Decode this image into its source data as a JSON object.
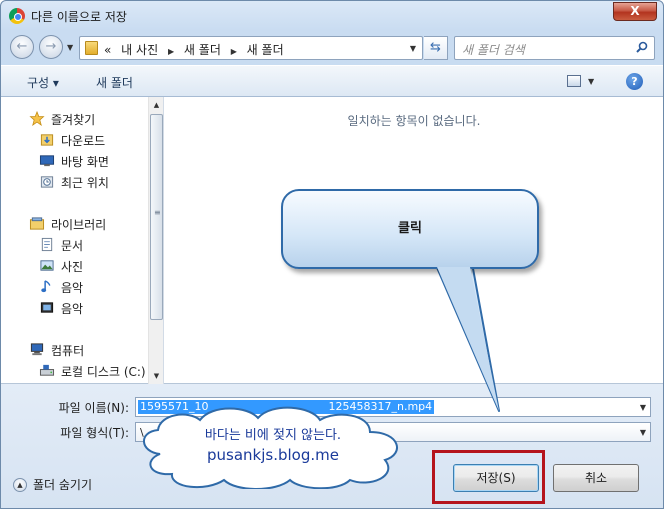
{
  "window": {
    "title": "다른 이름으로 저장",
    "close_symbol": "X"
  },
  "address": {
    "prefix": "«",
    "crumbs": [
      "내 사진",
      "새 폴더",
      "새 폴더"
    ],
    "search_placeholder": "새 폴더 검색"
  },
  "toolbar": {
    "organize": "구성 ▾",
    "new_folder": "새 폴더",
    "help": "?"
  },
  "nav": {
    "favorites": "즐겨찾기",
    "downloads": "다운로드",
    "desktop": "바탕 화면",
    "recent": "최근 위치",
    "libraries": "라이브러리",
    "documents": "문서",
    "pictures": "사진",
    "music1": "음악",
    "music2": "음악",
    "computer": "컴퓨터",
    "local_disk": "로컬 디스크 (C:)"
  },
  "main": {
    "empty_message": "일치하는 항목이 없습니다."
  },
  "fields": {
    "filename_label": "파일 이름(N):",
    "filename_value": "1595571_10",
    "filename_value_tail": "125458317_n.mp4",
    "filetype_label": "파일 형식(T):",
    "filetype_value": "\\"
  },
  "footer": {
    "hide_folders": "폴더 숨기기",
    "save_label": "저장(S)",
    "cancel_label": "취소"
  },
  "annotations": {
    "callout_text": "클릭",
    "cloud_line1": "바다는 비에 젖지 않는다.",
    "cloud_line2": "pusankjs.blog.me"
  },
  "colors": {
    "selection": "#3399ff",
    "highlight_box": "#b5141c",
    "callout_border": "#2f6aa8"
  }
}
